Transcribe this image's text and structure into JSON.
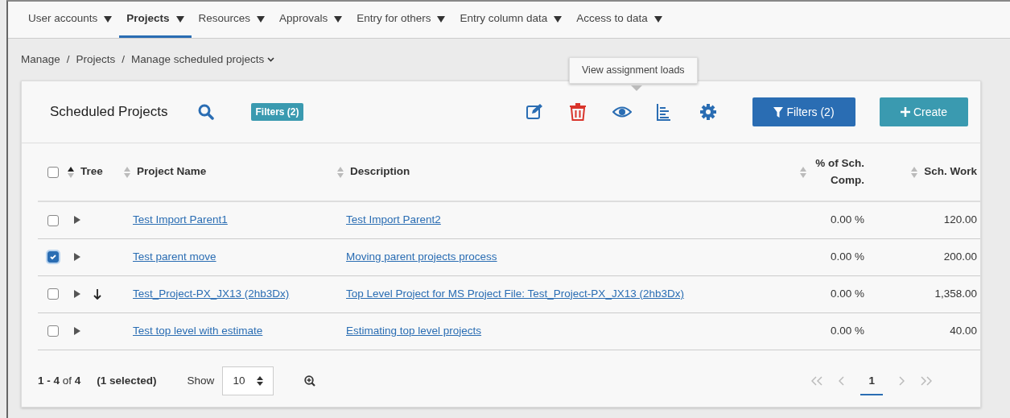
{
  "nav": [
    {
      "label": "User accounts",
      "selected": false
    },
    {
      "label": "Projects",
      "selected": true
    },
    {
      "label": "Resources",
      "selected": false
    },
    {
      "label": "Approvals",
      "selected": false
    },
    {
      "label": "Entry for others",
      "selected": false
    },
    {
      "label": "Entry column data",
      "selected": false
    },
    {
      "label": "Access to data",
      "selected": false
    }
  ],
  "breadcrumb": [
    "Manage",
    "Projects",
    "Manage scheduled projects"
  ],
  "breadcrumb_separator": "/",
  "card": {
    "title": "Scheduled Projects",
    "filter_badge": "Filters (2)",
    "tooltip": "View assignment loads",
    "filters_button": "Filters (2)",
    "create_button": "Create"
  },
  "table": {
    "all_checked": false,
    "columns": [
      {
        "label": "Tree",
        "sorted": true,
        "kind": "text"
      },
      {
        "label": "Project Name",
        "sorted": false,
        "kind": "text"
      },
      {
        "label": "Description",
        "sorted": false,
        "kind": "text"
      },
      {
        "label": "% of Sch. Comp.",
        "sorted": false,
        "kind": "number"
      },
      {
        "label": "Sch. Work",
        "sorted": false,
        "kind": "number"
      }
    ],
    "rows": [
      {
        "checked": false,
        "down_arrow": false,
        "name": "Test Import Parent1",
        "description": "Test Import Parent2",
        "pct": "0.00 %",
        "work": "120.00"
      },
      {
        "checked": true,
        "down_arrow": false,
        "name": "Test parent move",
        "description": "Moving parent projects process",
        "pct": "0.00 %",
        "work": "200.00"
      },
      {
        "checked": false,
        "down_arrow": true,
        "name": "Test_Project-PX_JX13 (2hb3Dx)",
        "description": "Top Level Project for MS Project File: Test_Project-PX_JX13 (2hb3Dx)",
        "pct": "0.00 %",
        "work": "1,358.00"
      },
      {
        "checked": false,
        "down_arrow": false,
        "name": "Test top level with estimate",
        "description": "Estimating top level projects",
        "pct": "0.00 %",
        "work": "40.00"
      }
    ]
  },
  "footer": {
    "range": "**1 - 4** of **4**",
    "selected": "(1 selected)",
    "show_label": "Show",
    "page_size": "10",
    "page": "1"
  }
}
